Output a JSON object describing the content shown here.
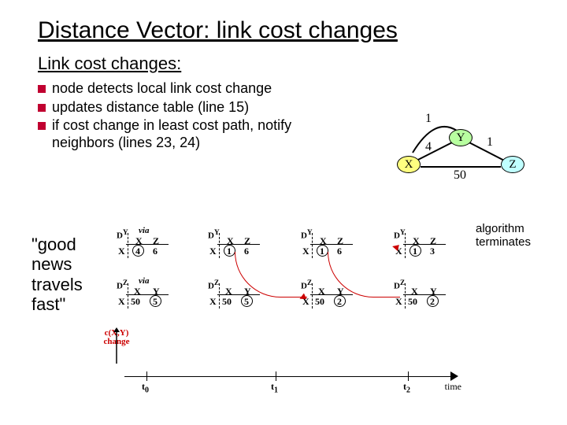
{
  "title": "Distance Vector: link cost changes",
  "subhead": "Link cost changes:",
  "bullets": [
    "node detects local link cost change",
    "updates distance table (line 15)",
    "if cost change in least cost path, notify neighbors (lines 23, 24)"
  ],
  "graph": {
    "nodes": {
      "X": "X",
      "Y": "Y",
      "Z": "Z"
    },
    "edge_XY_old": "4",
    "edge_XY_new": "1",
    "edge_YZ": "1",
    "edge_XZ": "50"
  },
  "quote": "\"good news travels fast\"",
  "algo_note": "algorithm terminates",
  "cxy_label": "c(X,Y) change",
  "time_label": "time",
  "ticks": [
    "t",
    "t",
    "t"
  ],
  "tick_subs": [
    "0",
    "1",
    "2"
  ],
  "tables": {
    "t0": {
      "DY": {
        "corner": "D",
        "sup": "Y",
        "cols": [
          "X",
          "Z"
        ],
        "row": "X",
        "vals": [
          "4",
          "6"
        ]
      },
      "DZ": {
        "corner": "D",
        "sup": "Z",
        "cols": [
          "X",
          "Y"
        ],
        "row": "X",
        "vals": [
          "50",
          "5"
        ]
      }
    },
    "t1a": {
      "DY": {
        "corner": "D",
        "sup": "Y",
        "cols": [
          "X",
          "Z"
        ],
        "row": "X",
        "vals": [
          "1",
          "6"
        ]
      },
      "DZ": {
        "corner": "D",
        "sup": "Z",
        "cols": [
          "X",
          "Y"
        ],
        "row": "X",
        "vals": [
          "50",
          "5"
        ]
      }
    },
    "t1b": {
      "DY": {
        "corner": "D",
        "sup": "Y",
        "cols": [
          "X",
          "Z"
        ],
        "row": "X",
        "vals": [
          "1",
          "6"
        ]
      },
      "DZ": {
        "corner": "D",
        "sup": "Z",
        "cols": [
          "X",
          "Y"
        ],
        "row": "X",
        "vals": [
          "50",
          "2"
        ]
      }
    },
    "t2": {
      "DY": {
        "corner": "D",
        "sup": "Y",
        "cols": [
          "X",
          "Z"
        ],
        "row": "X",
        "vals": [
          "1",
          "3"
        ]
      },
      "DZ": {
        "corner": "D",
        "sup": "Z",
        "cols": [
          "X",
          "Y"
        ],
        "row": "X",
        "vals": [
          "50",
          "2"
        ]
      }
    }
  }
}
